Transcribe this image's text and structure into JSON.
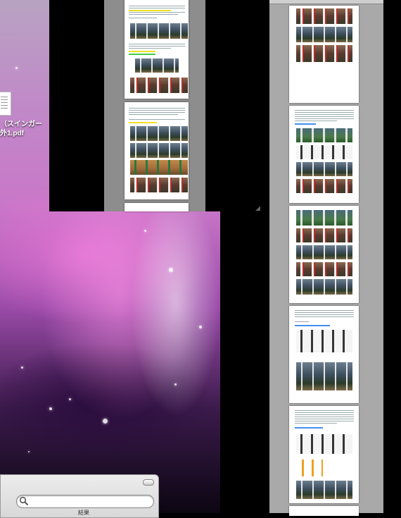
{
  "desktop": {
    "file_label": "（スインガー\n外1.pdf"
  },
  "search_panel": {
    "search_placeholder": "",
    "label": "結果"
  },
  "icons": {
    "search": "magnifier-icon",
    "file": "pdf-file-icon",
    "resize": "resize-grip-icon",
    "toggle": "toolbar-toggle-icon"
  },
  "colors": {
    "doc_background": "#a9a9a9",
    "window_background": "#000000",
    "highlight_yellow": "#f0e020",
    "highlight_green": "#40d040"
  }
}
